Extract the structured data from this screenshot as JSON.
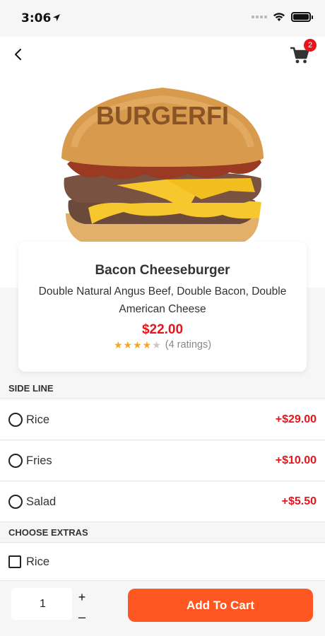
{
  "status_bar": {
    "time": "3:06"
  },
  "nav": {
    "cart_count": "2"
  },
  "product": {
    "name": "Bacon Cheeseburger",
    "description": "Double Natural Angus Beef, Double Bacon, Double American Cheese",
    "price": "$22.00",
    "rating_stars": 4,
    "rating_max": 5,
    "ratings_text": "(4 ratings)",
    "bun_brand": "BURGERFI"
  },
  "side_line": {
    "header": "SIDE LINE",
    "options": [
      {
        "label": "Rice",
        "price": "+$29.00"
      },
      {
        "label": "Fries",
        "price": "+$10.00"
      },
      {
        "label": "Salad",
        "price": "+$5.50"
      }
    ]
  },
  "extras": {
    "header": "CHOOSE EXTRAS",
    "options": [
      {
        "label": "Rice"
      }
    ]
  },
  "bottom": {
    "quantity": "1",
    "plus": "+",
    "minus": "–",
    "add_to_cart": "Add To Cart"
  },
  "colors": {
    "accent_red": "#e8141b",
    "button_orange": "#fe5722",
    "star_yellow": "#f5a623",
    "star_gray": "#c8c8c8"
  }
}
